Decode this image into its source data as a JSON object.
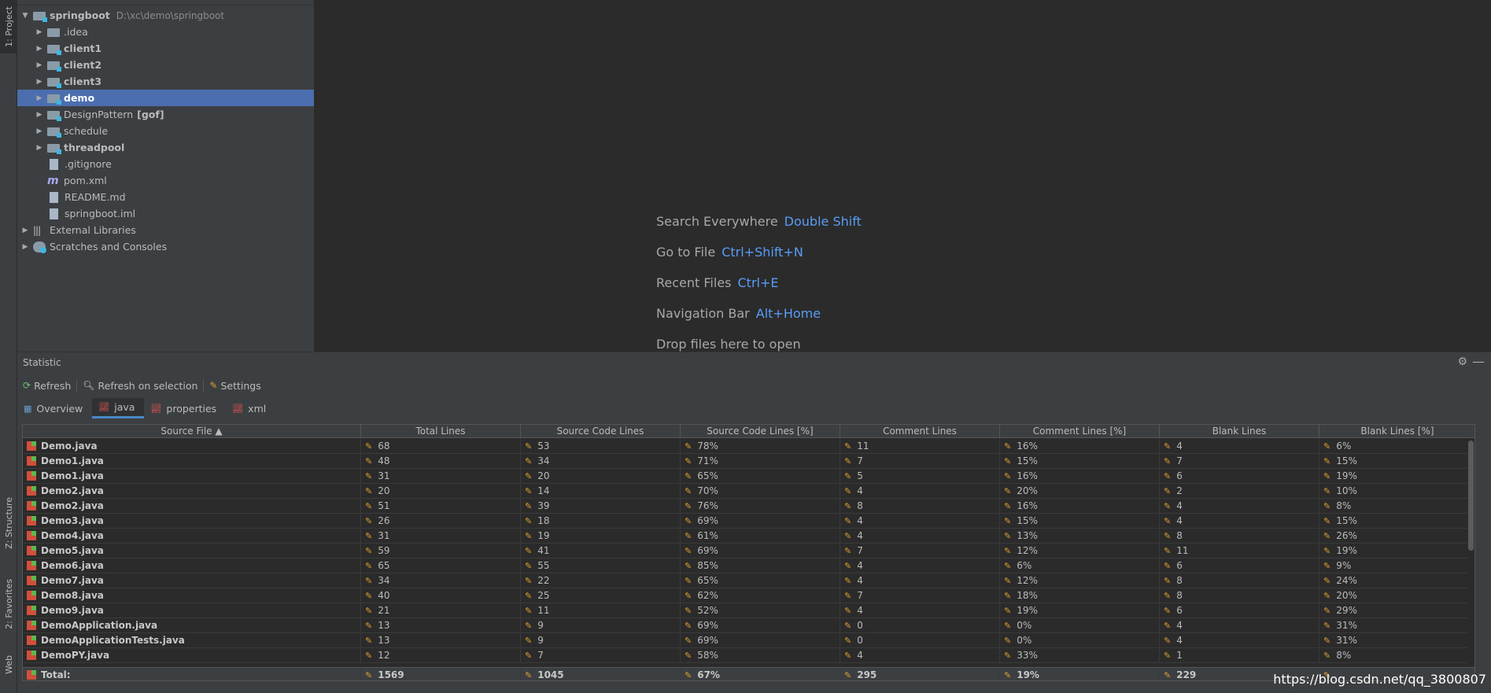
{
  "left_strip": {
    "project_tab": "1: Project",
    "structure_tab": "Z: Structure",
    "favorites_tab": "2: Favorites",
    "web_tab": "Web"
  },
  "project": {
    "root": {
      "name": "springboot",
      "path": "D:\\xc\\demo\\springboot"
    },
    "items": [
      {
        "label": ".idea",
        "bold": false,
        "kind": "folder"
      },
      {
        "label": "client1",
        "bold": true,
        "kind": "module"
      },
      {
        "label": "client2",
        "bold": true,
        "kind": "module"
      },
      {
        "label": "client3",
        "bold": true,
        "kind": "module"
      },
      {
        "label": "demo",
        "bold": true,
        "kind": "module",
        "selected": true
      },
      {
        "label": "DesignPattern",
        "suffix": "[gof]",
        "bold": false,
        "kind": "module"
      },
      {
        "label": "schedule",
        "bold": false,
        "kind": "module"
      },
      {
        "label": "threadpool",
        "bold": true,
        "kind": "module"
      },
      {
        "label": ".gitignore",
        "kind": "file"
      },
      {
        "label": "pom.xml",
        "kind": "maven"
      },
      {
        "label": "README.md",
        "kind": "file"
      },
      {
        "label": "springboot.iml",
        "kind": "file"
      }
    ],
    "external_libraries": "External Libraries",
    "scratches": "Scratches and Consoles"
  },
  "editor": {
    "hints": [
      {
        "text": "Search Everywhere",
        "key": "Double Shift"
      },
      {
        "text": "Go to File",
        "key": "Ctrl+Shift+N"
      },
      {
        "text": "Recent Files",
        "key": "Ctrl+E"
      },
      {
        "text": "Navigation Bar",
        "key": "Alt+Home"
      },
      {
        "text": "Drop files here to open",
        "key": ""
      }
    ]
  },
  "statistic": {
    "title": "Statistic",
    "toolbar": {
      "refresh": "Refresh",
      "refresh_selection": "Refresh on selection",
      "settings": "Settings"
    },
    "tabs": [
      {
        "label": "Overview",
        "active": false
      },
      {
        "label": "java",
        "active": true
      },
      {
        "label": "properties",
        "active": false
      },
      {
        "label": "xml",
        "active": false
      }
    ],
    "columns": [
      "Source File ▲",
      "Total Lines",
      "Source Code Lines",
      "Source Code Lines [%]",
      "Comment Lines",
      "Comment Lines [%]",
      "Blank Lines",
      "Blank Lines [%]"
    ],
    "rows": [
      [
        "Demo.java",
        "68",
        "53",
        "78%",
        "11",
        "16%",
        "4",
        "6%"
      ],
      [
        "Demo1.java",
        "48",
        "34",
        "71%",
        "7",
        "15%",
        "7",
        "15%"
      ],
      [
        "Demo1.java",
        "31",
        "20",
        "65%",
        "5",
        "16%",
        "6",
        "19%"
      ],
      [
        "Demo2.java",
        "20",
        "14",
        "70%",
        "4",
        "20%",
        "2",
        "10%"
      ],
      [
        "Demo2.java",
        "51",
        "39",
        "76%",
        "8",
        "16%",
        "4",
        "8%"
      ],
      [
        "Demo3.java",
        "26",
        "18",
        "69%",
        "4",
        "15%",
        "4",
        "15%"
      ],
      [
        "Demo4.java",
        "31",
        "19",
        "61%",
        "4",
        "13%",
        "8",
        "26%"
      ],
      [
        "Demo5.java",
        "59",
        "41",
        "69%",
        "7",
        "12%",
        "11",
        "19%"
      ],
      [
        "Demo6.java",
        "65",
        "55",
        "85%",
        "4",
        "6%",
        "6",
        "9%"
      ],
      [
        "Demo7.java",
        "34",
        "22",
        "65%",
        "4",
        "12%",
        "8",
        "24%"
      ],
      [
        "Demo8.java",
        "40",
        "25",
        "62%",
        "7",
        "18%",
        "8",
        "20%"
      ],
      [
        "Demo9.java",
        "21",
        "11",
        "52%",
        "4",
        "19%",
        "6",
        "29%"
      ],
      [
        "DemoApplication.java",
        "13",
        "9",
        "69%",
        "0",
        "0%",
        "4",
        "31%"
      ],
      [
        "DemoApplicationTests.java",
        "13",
        "9",
        "69%",
        "0",
        "0%",
        "4",
        "31%"
      ],
      [
        "DemoPY.java",
        "12",
        "7",
        "58%",
        "4",
        "33%",
        "1",
        "8%"
      ]
    ],
    "total": [
      "Total:",
      "1569",
      "1045",
      "67%",
      "295",
      "19%",
      "229",
      ""
    ]
  },
  "watermark": "https://blog.csdn.net/qq_3800807"
}
